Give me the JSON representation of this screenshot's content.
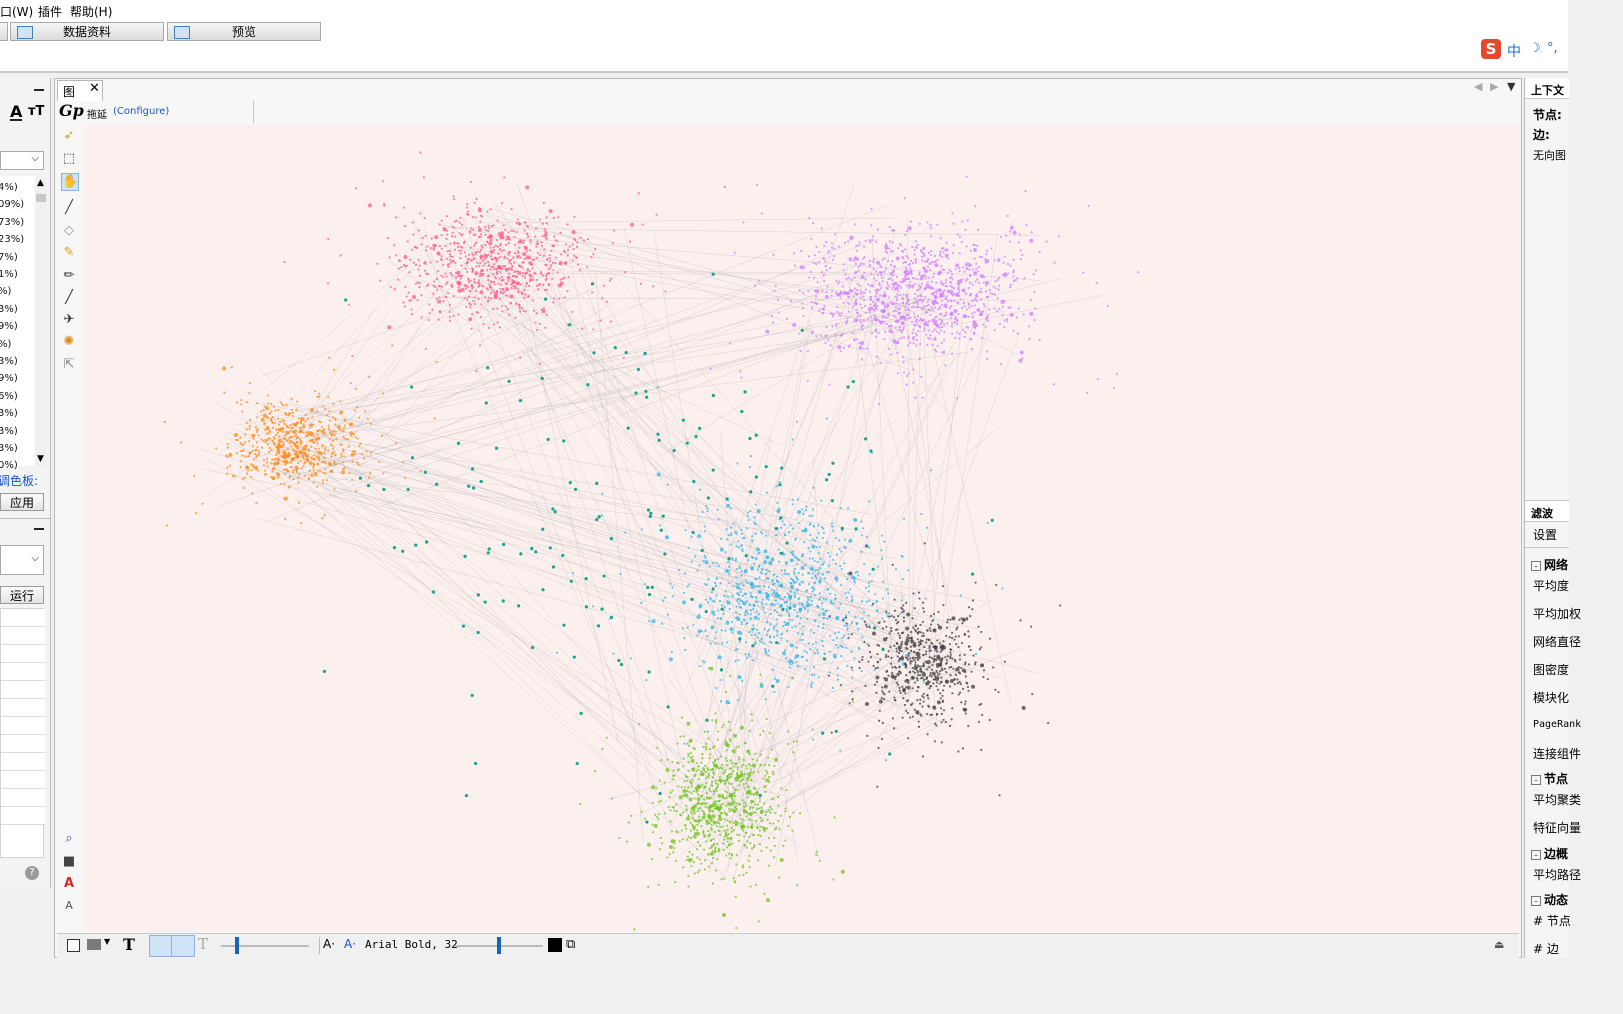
{
  "menu": {
    "window": "口(W)",
    "plugins": "插件",
    "help": "帮助(H)"
  },
  "toolbar": {
    "data_tab": "数据资料",
    "preview_tab": "预览"
  },
  "ime": {
    "logo": "S",
    "mode": "中"
  },
  "left_panel": {
    "percentages": [
      "4%)",
      "09%)",
      "73%)",
      "23%)",
      "7%)",
      "1%)",
      "%)",
      "3%)",
      "9%)",
      "%)",
      "3%)",
      "9%)",
      "6%)",
      "3%)",
      "3%)",
      "3%)",
      "0%)"
    ],
    "palette_label": "调色板:",
    "apply_button": "应用",
    "run_button": "运行"
  },
  "graph": {
    "tab_label": "图",
    "mode_label": "拖延",
    "configure_link": "(Configure)"
  },
  "bottom_bar": {
    "font_label": "Arial Bold, 32"
  },
  "right_panel": {
    "context_tab": "上下文",
    "nodes_label": "节点:",
    "edges_label": "边:",
    "graph_type": "无向图",
    "filter_tab": "滤波",
    "settings_label": "设置",
    "network_section": "网络",
    "avg_degree": "平均度",
    "avg_weighted_degree": "平均加权",
    "network_diameter": "网络直径",
    "graph_density": "图密度",
    "modularity": "模块化",
    "pagerank": "PageRank",
    "connected_components": "连接组件",
    "node_section": "节点",
    "avg_clustering": "平均聚类",
    "eigenvector": "特征向量",
    "edge_section": "边概",
    "avg_path": "平均路径",
    "dynamic_section": "动态",
    "node_count": "# 节点",
    "edge_count": "# 边"
  },
  "colors": {
    "canvas_bg": "#fcf0ef",
    "pink": "#ff5a8c",
    "violet": "#d27eff",
    "orange": "#ff8a14",
    "cyan": "#33b5e8",
    "green": "#6cc41c",
    "dark": "#3d3d3d",
    "teal": "#1aa38c",
    "link": "#1a55c4"
  }
}
